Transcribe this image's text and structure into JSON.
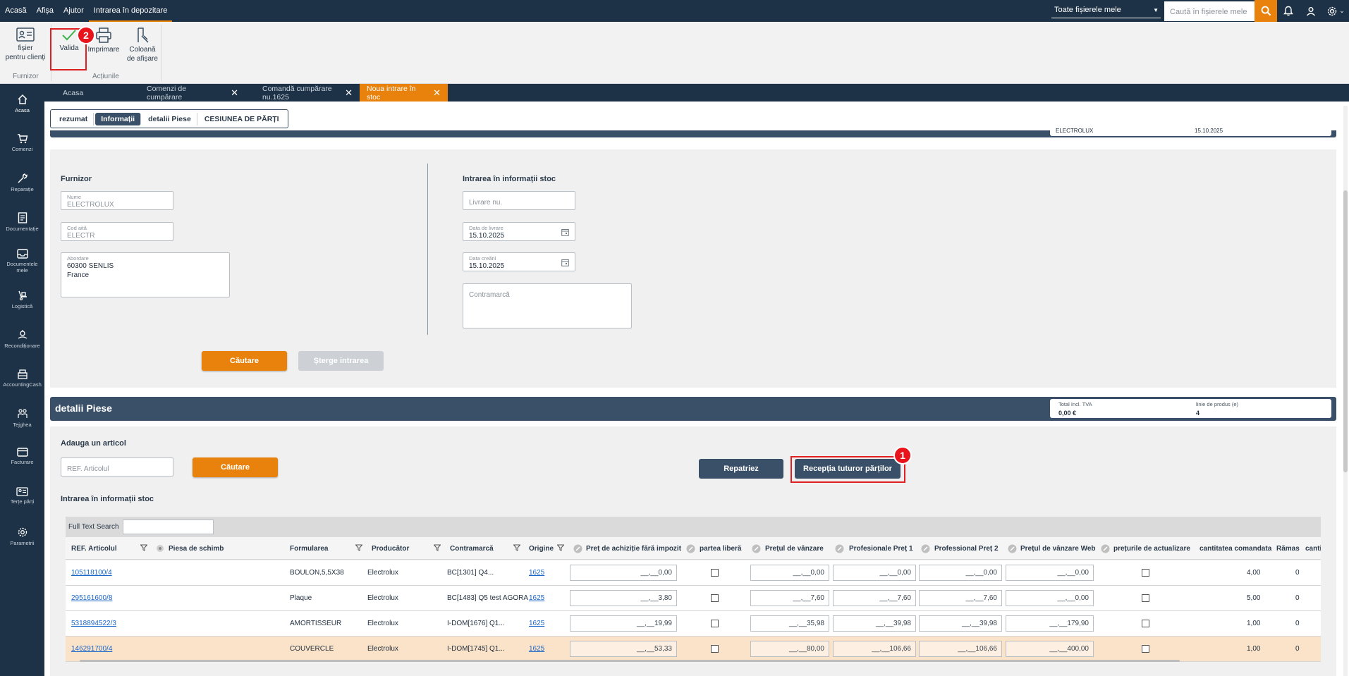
{
  "topmenu": {
    "items": [
      "Acasă",
      "Afișa",
      "Ajutor",
      "Intrarea în depozitare"
    ],
    "active_index": 3,
    "workspace_select": "Toate fișierele mele",
    "search_placeholder": "Caută în fișierele mele"
  },
  "ribbon": {
    "client_file": "fișier pentru clienți",
    "client_file_line1": "fișier",
    "client_file_line2": "pentru clienți",
    "validate": "Valida",
    "print": "Imprimare",
    "display_col_line1": "Coloană",
    "display_col_line2": "de afișare",
    "group_supplier": "Furnizor",
    "group_actions": "Acțiunile"
  },
  "badges": {
    "one": "1",
    "two": "2"
  },
  "sidebar": {
    "items": [
      {
        "label": "Acasa",
        "icon": "home-icon"
      },
      {
        "label": "Comenzi",
        "icon": "cart-icon"
      },
      {
        "label": "Reparație",
        "icon": "wrench-icon"
      },
      {
        "label": "Documentație",
        "icon": "document-icon"
      },
      {
        "label1": "Documentele",
        "label2": "mele",
        "icon": "inbox-icon"
      },
      {
        "label": "Logistică",
        "icon": "logistics-icon"
      },
      {
        "label": "Recondiționare",
        "icon": "recondition-icon"
      },
      {
        "label": "AccountingCash",
        "icon": "cash-register-icon"
      },
      {
        "label": "Tejghea",
        "icon": "counter-icon"
      },
      {
        "label": "Facturare",
        "icon": "card-icon"
      },
      {
        "label": "Terțe părți",
        "icon": "contact-card-icon"
      },
      {
        "label": "Parametrii",
        "icon": "gear-icon"
      }
    ]
  },
  "tabs": [
    {
      "label": "Acasa"
    },
    {
      "label": "Comenzi de cumpărare"
    },
    {
      "label": "Comandă cumpărare nu.1625"
    },
    {
      "label": "Noua intrare în stoc"
    }
  ],
  "subtabs": [
    "rezumat",
    "Informații",
    "detalii Piese",
    "CESIUNEA DE PĂRȚI"
  ],
  "info_panel": {
    "header_left": "ELECTROLUX",
    "header_right": "15.10.2025",
    "supplier_title": "Furnizor",
    "name_label": "Nume",
    "name_value": "ELECTROLUX",
    "code_label": "Cod aită",
    "code_value": "ELECTR",
    "address_label": "Abordare",
    "address_line1": "60300 SENLIS",
    "address_line2": "France",
    "stock_title": "Intrarea în informații stoc",
    "delivery_no_placeholder": "Livrare nu.",
    "delivery_date_label": "Data de livrare",
    "delivery_date_value": "15.10.2025",
    "creation_date_label": "Data creării",
    "creation_date_value": "15.10.2025",
    "countermark_placeholder": "Contramarcă",
    "search_btn": "Căutare",
    "delete_btn": "Șterge intrarea"
  },
  "details": {
    "title": "detalii Piese",
    "total_label": "Total Incl. TVA",
    "total_value": "0,00 €",
    "lines_label": "linie de produs (e)",
    "lines_value": "4",
    "add_article_title": "Adauga un articol",
    "ref_placeholder": "REF. Articolul",
    "search_btn": "Căutare",
    "repatriate_btn": "Repatriez",
    "receive_all_btn": "Recepția tuturor părților",
    "stock_info_title": "Intrarea în informații stoc",
    "full_text_search": "Full Text Search"
  },
  "table": {
    "columns": [
      "REF. Articolul",
      "Piesa de schimb",
      "Formularea",
      "Producător",
      "Contramarcă",
      "Origine",
      "Preț de achiziție fără impozit",
      "partea liberă",
      "Prețul de vânzare",
      "Profesionale Preț 1",
      "Professional Preț 2",
      "Prețul de vânzare Web",
      "prețurile de actualizare",
      "cantitatea comandata",
      "Rămas",
      "canti"
    ],
    "rows": [
      {
        "ref": "105118100/4",
        "formulation": "BOULON,5,5X38",
        "maker": "Electrolux",
        "countermark": "BC[1301] Q4...",
        "origin": "1625",
        "purchase": "__,__0,00",
        "sale": "__,__0,00",
        "pro1": "__,__0,00",
        "pro2": "__,__0,00",
        "web": "__,__0,00",
        "qty": "4,00",
        "remaining": "0"
      },
      {
        "ref": "295161600/8",
        "formulation": "Plaque",
        "maker": "Electrolux",
        "countermark": "BC[1483] Q5 test AGORA",
        "origin": "1625",
        "purchase": "__,__3,80",
        "sale": "__,__7,60",
        "pro1": "__,__7,60",
        "pro2": "__,__7,60",
        "web": "__,__0,00",
        "qty": "5,00",
        "remaining": "0"
      },
      {
        "ref": "5318894522/3",
        "formulation": "AMORTISSEUR",
        "maker": "Electrolux",
        "countermark": "I-DOM[1676] Q1...",
        "origin": "1625",
        "purchase": "__,__19,99",
        "sale": "__,__35,98",
        "pro1": "__,__39,98",
        "pro2": "__,__39,98",
        "web": "__,__179,90",
        "qty": "1,00",
        "remaining": "0"
      },
      {
        "ref": "146291700/4",
        "formulation": "COUVERCLE",
        "maker": "Electrolux",
        "countermark": "I-DOM[1745] Q1...",
        "origin": "1625",
        "purchase": "__,__53,33",
        "sale": "__,__80,00",
        "pro1": "__,__106,66",
        "pro2": "__,__106,66",
        "web": "__,__400,00",
        "qty": "1,00",
        "remaining": "0"
      }
    ]
  },
  "colors": {
    "navy": "#1e3247",
    "panel_navy": "#3a5068",
    "orange": "#e8820c",
    "highlight_red": "#e02020",
    "badge_red": "#e8131b",
    "link_blue": "#1a66c8",
    "selected_row": "#fbe3c9"
  }
}
